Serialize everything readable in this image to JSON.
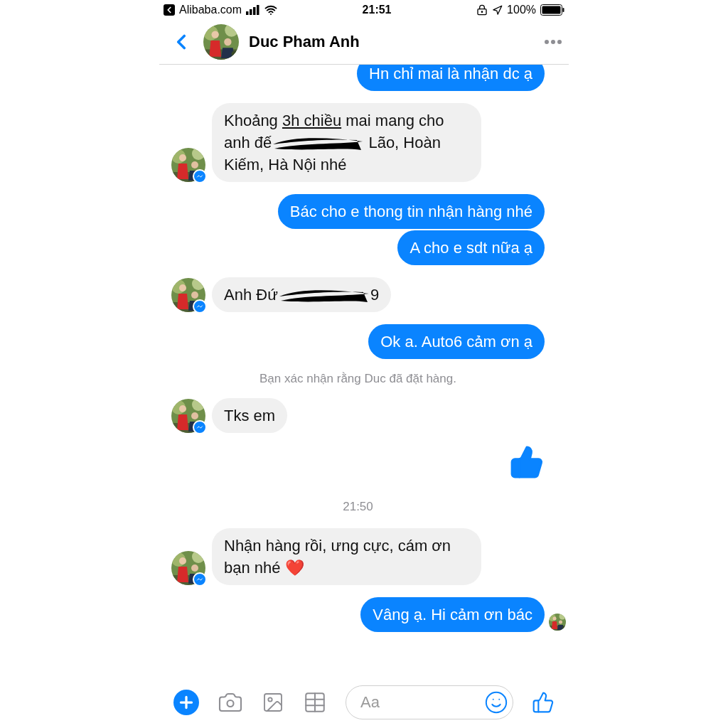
{
  "status_bar": {
    "back_app": "Alibaba.com",
    "time": "21:51",
    "battery": "100%"
  },
  "header": {
    "name": "Duc Pham Anh"
  },
  "messages": [
    {
      "kind": "sent",
      "segments": [
        {
          "text": "Hn chỉ mai là nhận dc ạ"
        }
      ]
    },
    {
      "kind": "received",
      "segments": [
        {
          "text": "Khoảng "
        },
        {
          "text": "3h chiều",
          "underline": true
        },
        {
          "text": " mai mang cho anh đế"
        },
        {
          "kind": "redaction"
        },
        {
          "text": " Lão, Hoàn Kiếm, Hà Nội nhé"
        }
      ]
    },
    {
      "kind": "sent",
      "segments": [
        {
          "text": "Bác cho e thong tin nhận hàng nhé"
        }
      ]
    },
    {
      "kind": "sent",
      "segments": [
        {
          "text": "A cho e sdt nữa ạ"
        }
      ]
    },
    {
      "kind": "received",
      "segments": [
        {
          "text": "Anh Đứ"
        },
        {
          "kind": "redaction"
        },
        {
          "text": "9"
        }
      ]
    },
    {
      "kind": "sent",
      "segments": [
        {
          "text": "Ok a. Auto6 cảm ơn ạ"
        }
      ]
    },
    {
      "kind": "system",
      "text": "Bạn xác nhận rằng Duc đã đặt hàng."
    },
    {
      "kind": "received",
      "segments": [
        {
          "text": "Tks em"
        }
      ]
    },
    {
      "kind": "like"
    },
    {
      "kind": "timestamp",
      "text": "21:50"
    },
    {
      "kind": "received",
      "segments": [
        {
          "text": "Nhận hàng rồi, ưng cực, cám ơn bạn nhé ❤️"
        }
      ]
    },
    {
      "kind": "sent",
      "seen": true,
      "segments": [
        {
          "text": "Vâng ạ. Hi cảm ơn bác"
        }
      ]
    }
  ],
  "composer": {
    "placeholder": "Aa"
  }
}
